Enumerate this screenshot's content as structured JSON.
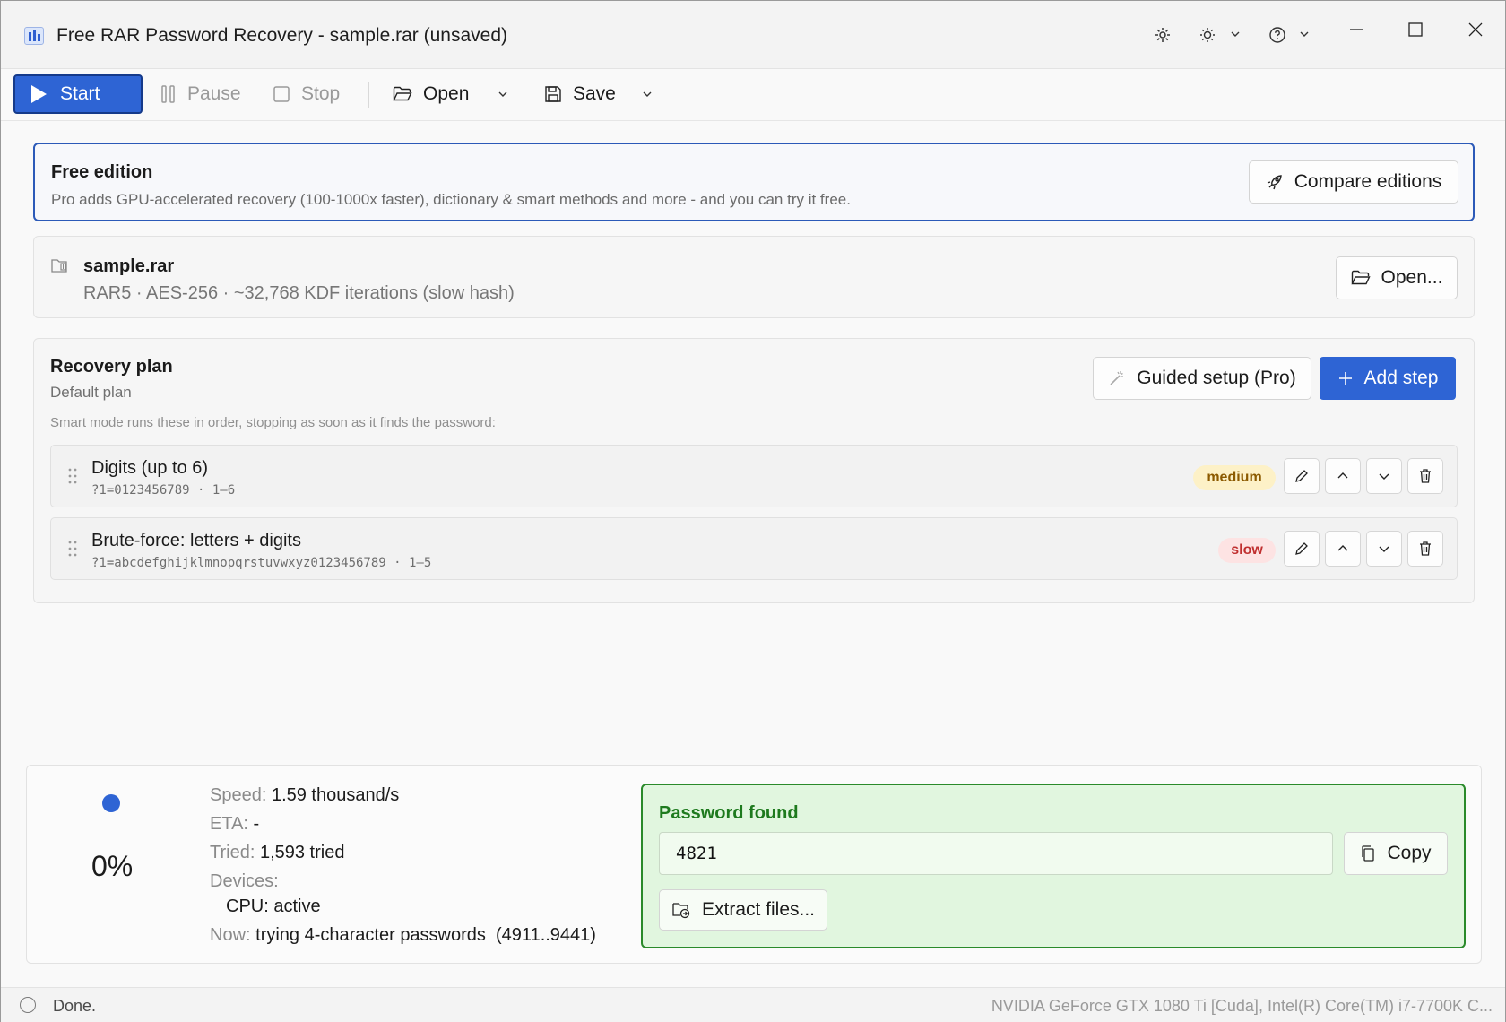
{
  "window": {
    "title": "Free RAR Password Recovery - sample.rar (unsaved)"
  },
  "toolbar": {
    "start_label": "Start",
    "pause_label": "Pause",
    "stop_label": "Stop",
    "open_label": "Open",
    "save_label": "Save"
  },
  "free_edition": {
    "title": "Free edition",
    "description": "Pro adds GPU-accelerated recovery (100-1000x faster), dictionary & smart methods and more - and you can try it free.",
    "compare_label": "Compare editions"
  },
  "file": {
    "name": "sample.rar",
    "details": "RAR5 · AES-256 · ~32,768 KDF iterations (slow hash)",
    "open_label": "Open..."
  },
  "plan": {
    "title": "Recovery plan",
    "subtitle": "Default plan",
    "hint": "Smart mode runs these in order, stopping as soon as it finds the password:",
    "guided_label": "Guided setup (Pro)",
    "add_label": "Add step",
    "steps": [
      {
        "title": "Digits (up to 6)",
        "mask": "?1=0123456789 · 1–6",
        "speed": "medium"
      },
      {
        "title": "Brute-force: letters + digits",
        "mask": "?1=abcdefghijklmnopqrstuvwxyz0123456789 · 1–5",
        "speed": "slow"
      }
    ]
  },
  "progress": {
    "percent": "0%",
    "speed_label": "Speed:",
    "speed_value": "1.59 thousand/s",
    "eta_label": "ETA:",
    "eta_value": "-",
    "tried_label": "Tried:",
    "tried_value": "1,593 tried",
    "devices_label": "Devices:",
    "device_cpu": "CPU: active",
    "now_label": "Now:",
    "now_value": "trying 4-character passwords  (4911..9441)"
  },
  "result": {
    "title": "Password found",
    "password": "4821",
    "copy_label": "Copy",
    "extract_label": "Extract files..."
  },
  "statusbar": {
    "status": "Done.",
    "hardware": "NVIDIA GeForce GTX 1080 Ti [Cuda], Intel(R) Core(TM) i7-7700K C..."
  },
  "colors": {
    "accent": "#2e64d4",
    "success": "#2a8a2a",
    "medium_badge": "#fdf1c7",
    "slow_badge": "#fde3e3"
  }
}
